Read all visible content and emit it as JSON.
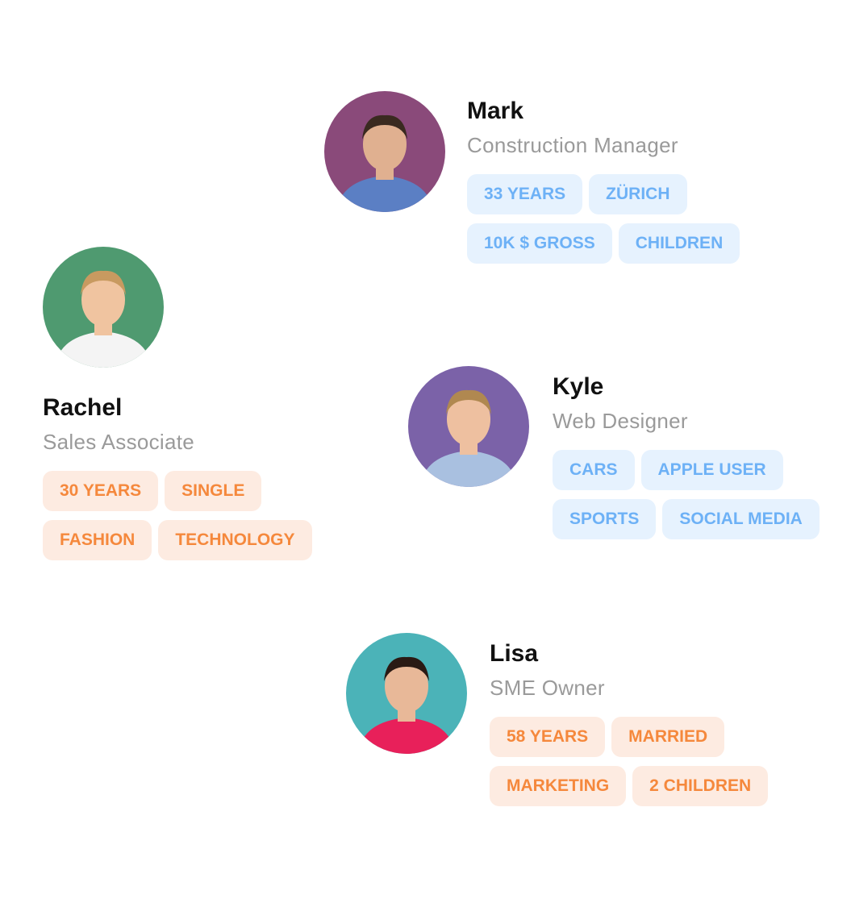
{
  "colors": {
    "blue_tag_bg": "#e6f2fe",
    "blue_tag_text": "#6db1f6",
    "orange_tag_bg": "#fdebe1",
    "orange_tag_text": "#f5883c"
  },
  "personas": [
    {
      "name": "Mark",
      "title": "Construction Manager",
      "avatar_bg": "#8a4a7a",
      "avatar_icon": "man-photo",
      "tags": [
        [
          "33 YEARS",
          "ZÜRICH"
        ],
        [
          "10K $ GROSS",
          "CHILDREN"
        ]
      ]
    },
    {
      "name": "Rachel",
      "title": "Sales Associate",
      "avatar_bg": "#4f9a70",
      "avatar_icon": "woman-photo",
      "tags": [
        [
          "30 YEARS",
          "SINGLE"
        ],
        [
          "FASHION",
          "TECHNOLOGY"
        ]
      ]
    },
    {
      "name": "Kyle",
      "title": "Web Designer",
      "avatar_bg": "#7b62a8",
      "avatar_icon": "man-photo",
      "tags": [
        [
          "CARS",
          "APPLE USER"
        ],
        [
          "SPORTS",
          "SOCIAL MEDIA"
        ]
      ]
    },
    {
      "name": "Lisa",
      "title": "SME Owner",
      "avatar_bg": "#4bb3b8",
      "avatar_icon": "woman-photo",
      "tags": [
        [
          "58 YEARS",
          "MARRIED"
        ],
        [
          "MARKETING",
          "2 CHILDREN"
        ]
      ]
    }
  ]
}
